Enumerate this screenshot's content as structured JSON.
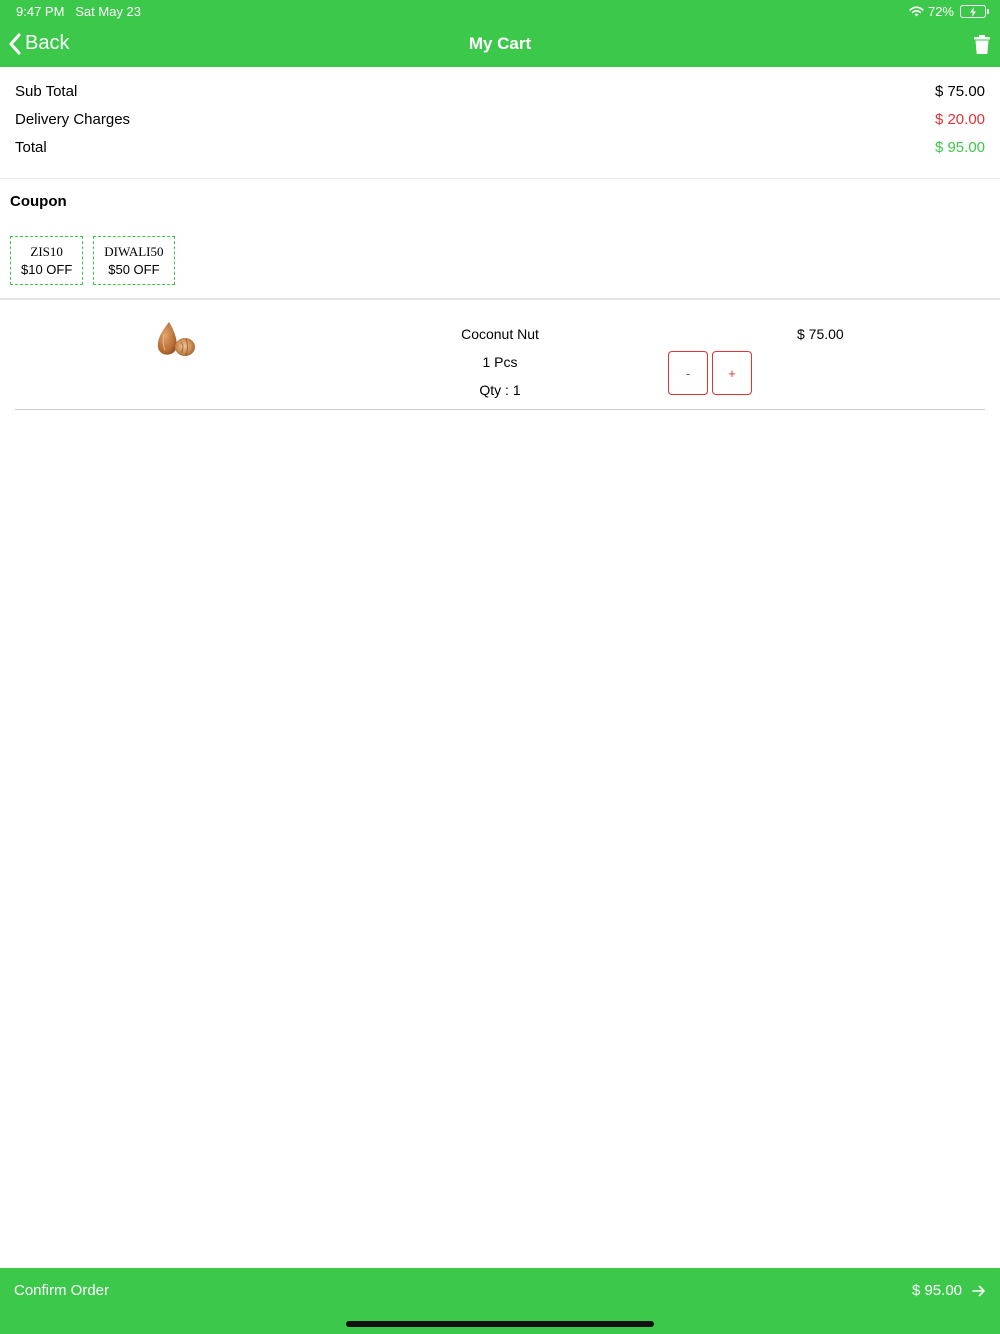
{
  "status_bar": {
    "time": "9:47 PM",
    "date": "Sat May 23",
    "battery": "72%"
  },
  "nav": {
    "back_label": "Back",
    "title": "My Cart"
  },
  "summary": {
    "subtotal_label": "Sub Total",
    "subtotal_value": "$ 75.00",
    "delivery_label": "Delivery Charges",
    "delivery_value": "$ 20.00",
    "total_label": "Total",
    "total_value": "$ 95.00"
  },
  "coupon": {
    "title": "Coupon",
    "items": [
      {
        "code": "ZIS10",
        "off": "$10 OFF"
      },
      {
        "code": "DIWALI50",
        "off": "$50 OFF"
      }
    ]
  },
  "cart_items": [
    {
      "name": "Coconut Nut",
      "unit": "1 Pcs",
      "qty": "Qty : 1",
      "price": "$ 75.00",
      "minus_label": "-",
      "plus_label": "+"
    }
  ],
  "footer": {
    "confirm_label": "Confirm Order",
    "total": "$ 95.00"
  },
  "colors": {
    "accent": "#3cc84a",
    "danger": "#e03333"
  }
}
